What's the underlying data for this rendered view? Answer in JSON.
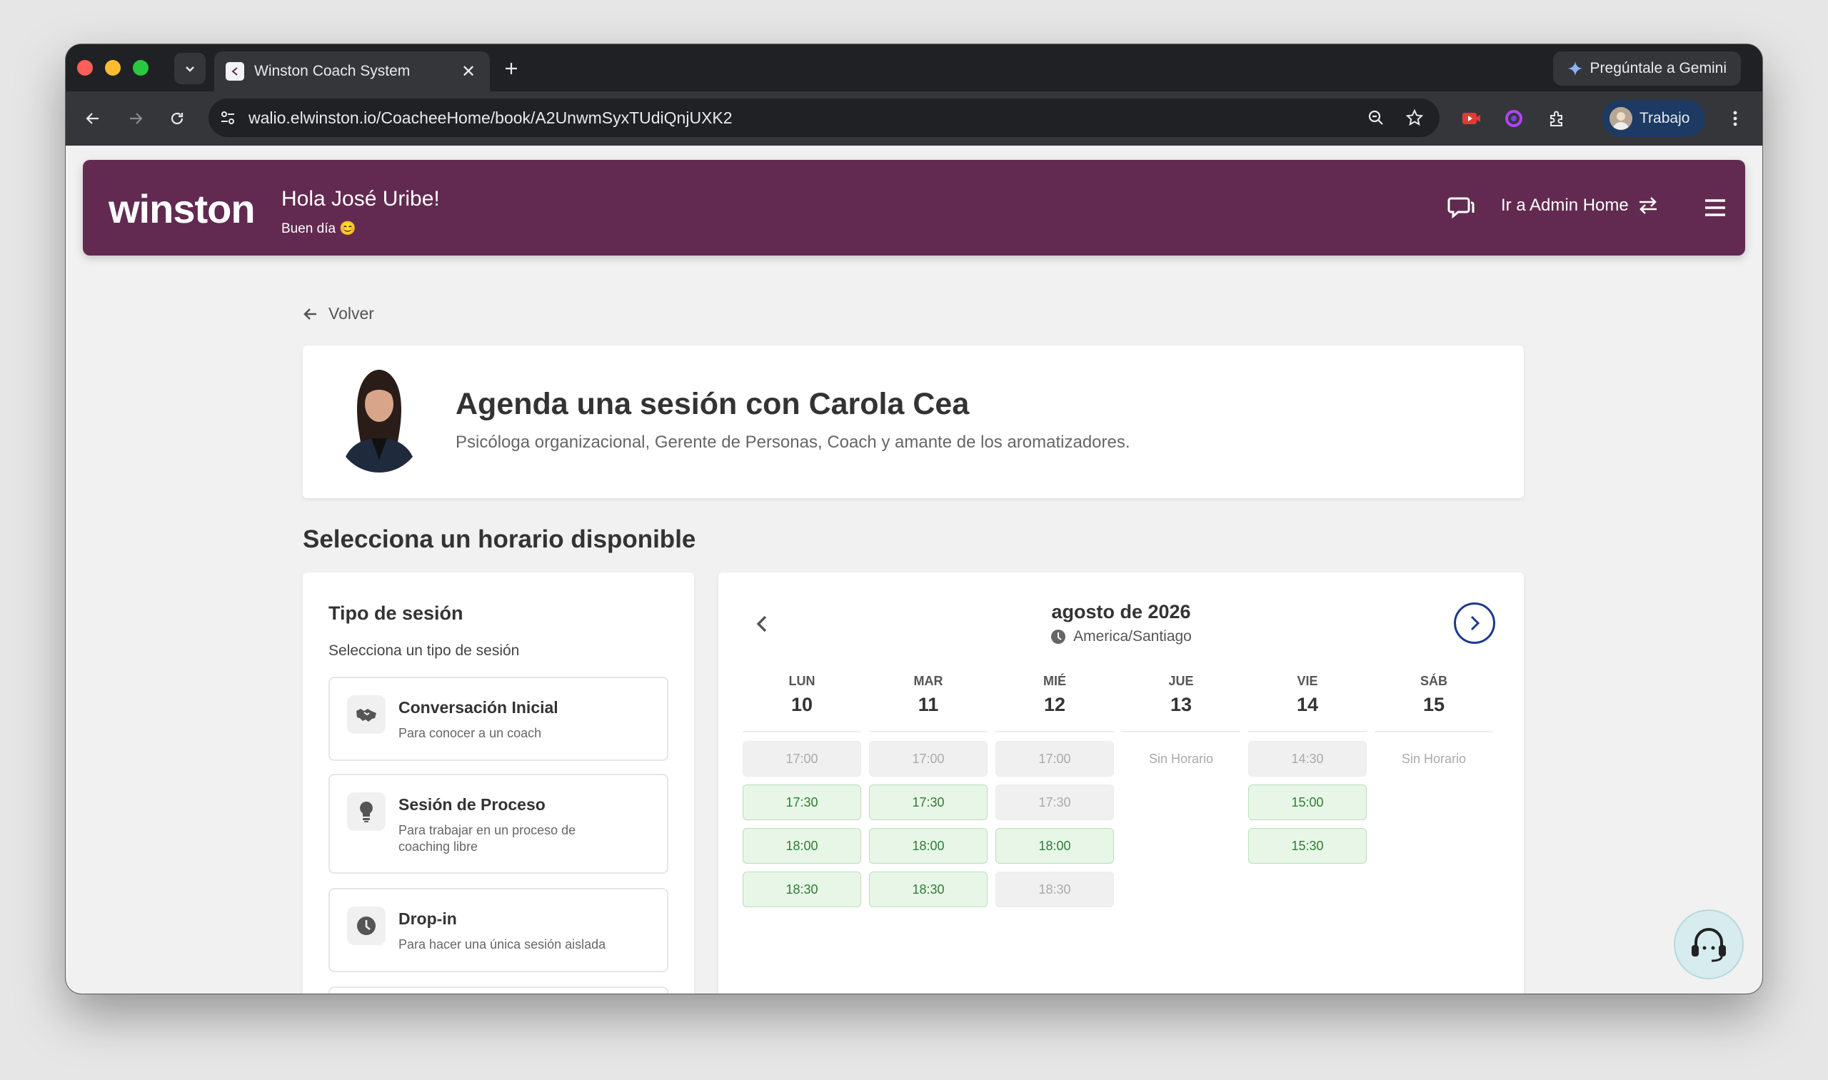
{
  "browser": {
    "tab_title": "Winston Coach System",
    "url": "walio.elwinston.io/CoacheeHome/book/A2UnwmSyxTUdiQnjUXK2",
    "gemini_label": "Pregúntale a Gemini",
    "profile_label": "Trabajo"
  },
  "header": {
    "logo": "winston",
    "greeting": "Hola José Uribe!",
    "subgreeting": "Buen día 😊",
    "admin_link": "Ir a Admin Home",
    "brand_color": "#622a51"
  },
  "back_label": "Volver",
  "coach": {
    "title": "Agenda una sesión con Carola Cea",
    "bio": "Psicóloga organizacional, Gerente de Personas, Coach y amante de los aromatizadores."
  },
  "section_title": "Selecciona un horario disponible",
  "session_types": {
    "title": "Tipo de sesión",
    "subtitle": "Selecciona un tipo de sesión",
    "options": [
      {
        "title": "Conversación Inicial",
        "desc": "Para conocer a un coach",
        "icon": "handshake-icon"
      },
      {
        "title": "Sesión de Proceso",
        "desc": "Para trabajar en un proceso de coaching libre",
        "icon": "lightbulb-icon"
      },
      {
        "title": "Drop-in",
        "desc": "Para hacer una única sesión aislada",
        "icon": "clock-icon"
      }
    ]
  },
  "calendar": {
    "month": "agosto de 2026",
    "timezone": "America/Santiago",
    "no_schedule": "Sin Horario",
    "days": [
      {
        "name": "LUN",
        "num": "10",
        "slots": [
          {
            "t": "17:00",
            "a": false
          },
          {
            "t": "17:30",
            "a": true
          },
          {
            "t": "18:00",
            "a": true
          },
          {
            "t": "18:30",
            "a": true
          }
        ]
      },
      {
        "name": "MAR",
        "num": "11",
        "slots": [
          {
            "t": "17:00",
            "a": false
          },
          {
            "t": "17:30",
            "a": true
          },
          {
            "t": "18:00",
            "a": true
          },
          {
            "t": "18:30",
            "a": true
          }
        ]
      },
      {
        "name": "MIÉ",
        "num": "12",
        "slots": [
          {
            "t": "17:00",
            "a": false
          },
          {
            "t": "17:30",
            "a": false
          },
          {
            "t": "18:00",
            "a": true
          },
          {
            "t": "18:30",
            "a": false
          }
        ]
      },
      {
        "name": "JUE",
        "num": "13",
        "slots": []
      },
      {
        "name": "VIE",
        "num": "14",
        "slots": [
          {
            "t": "14:30",
            "a": false
          },
          {
            "t": "15:00",
            "a": true
          },
          {
            "t": "15:30",
            "a": true
          }
        ]
      },
      {
        "name": "SÁB",
        "num": "15",
        "slots": []
      }
    ]
  }
}
